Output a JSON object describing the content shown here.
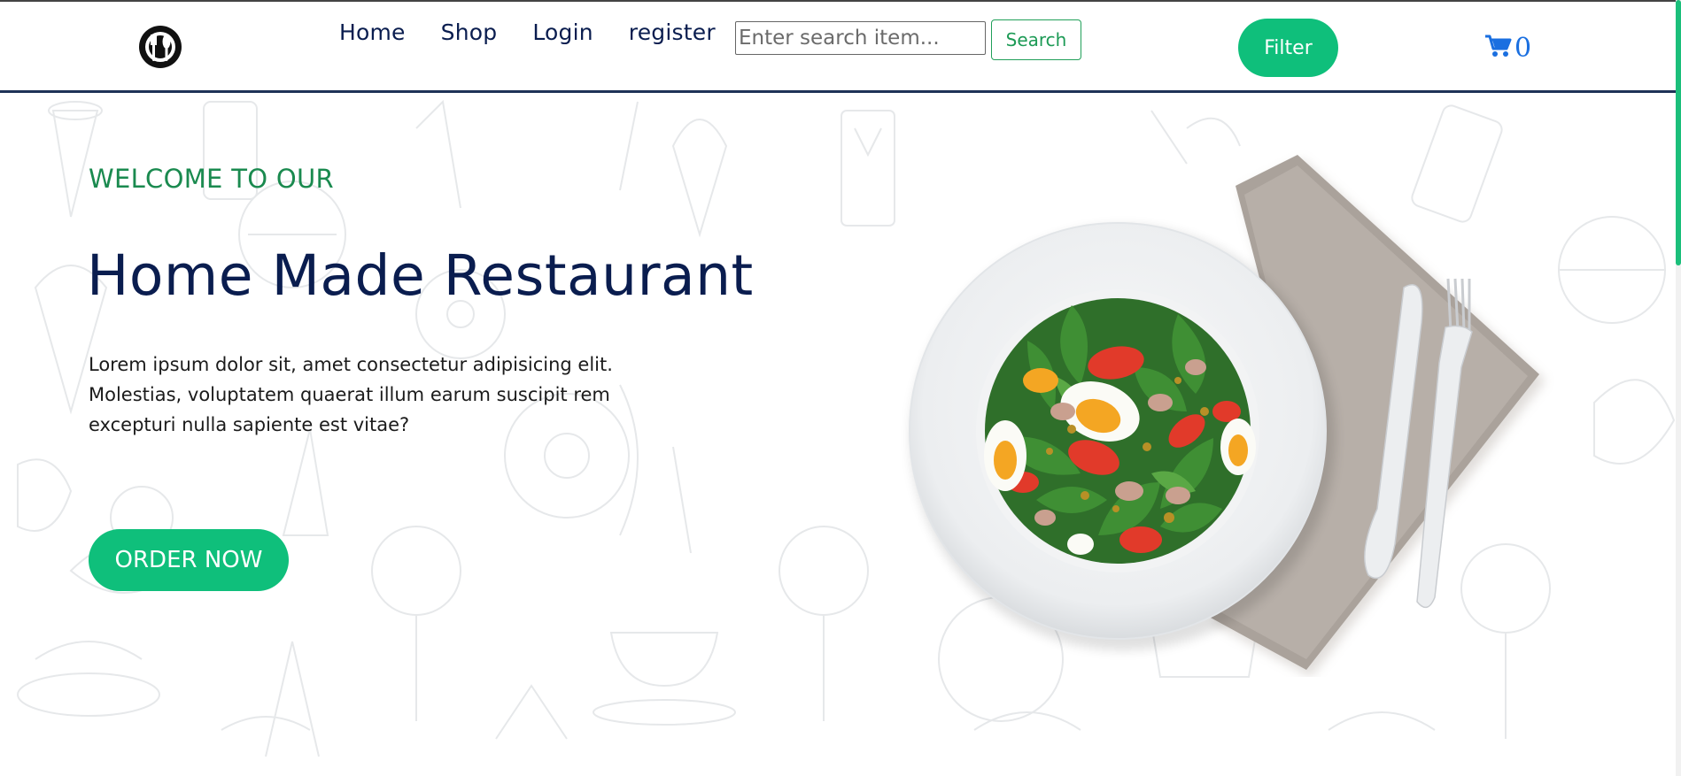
{
  "nav": {
    "links": [
      "Home",
      "Shop",
      "Login",
      "register"
    ],
    "search_placeholder": "Enter search item...",
    "search_label": "Search",
    "filter_label": "Filter",
    "cart_count": "0"
  },
  "hero": {
    "eyebrow": "WELCOME TO OUR",
    "title": "Home Made Restaurant",
    "description": "Lorem ipsum dolor sit, amet consectetur adipisicing elit. Molestias, voluptatem quaerat illum earum suscipit rem excepturi nulla sapiente est vitae?",
    "cta_label": "ORDER NOW"
  },
  "icons": {
    "logo": "restaurant-logo-icon",
    "cart": "cart-icon"
  },
  "colors": {
    "accent": "#0fbf7b",
    "navy": "#0a1d4f",
    "eyebrow": "#1a8a4f",
    "cart_blue": "#1a6fe0"
  }
}
